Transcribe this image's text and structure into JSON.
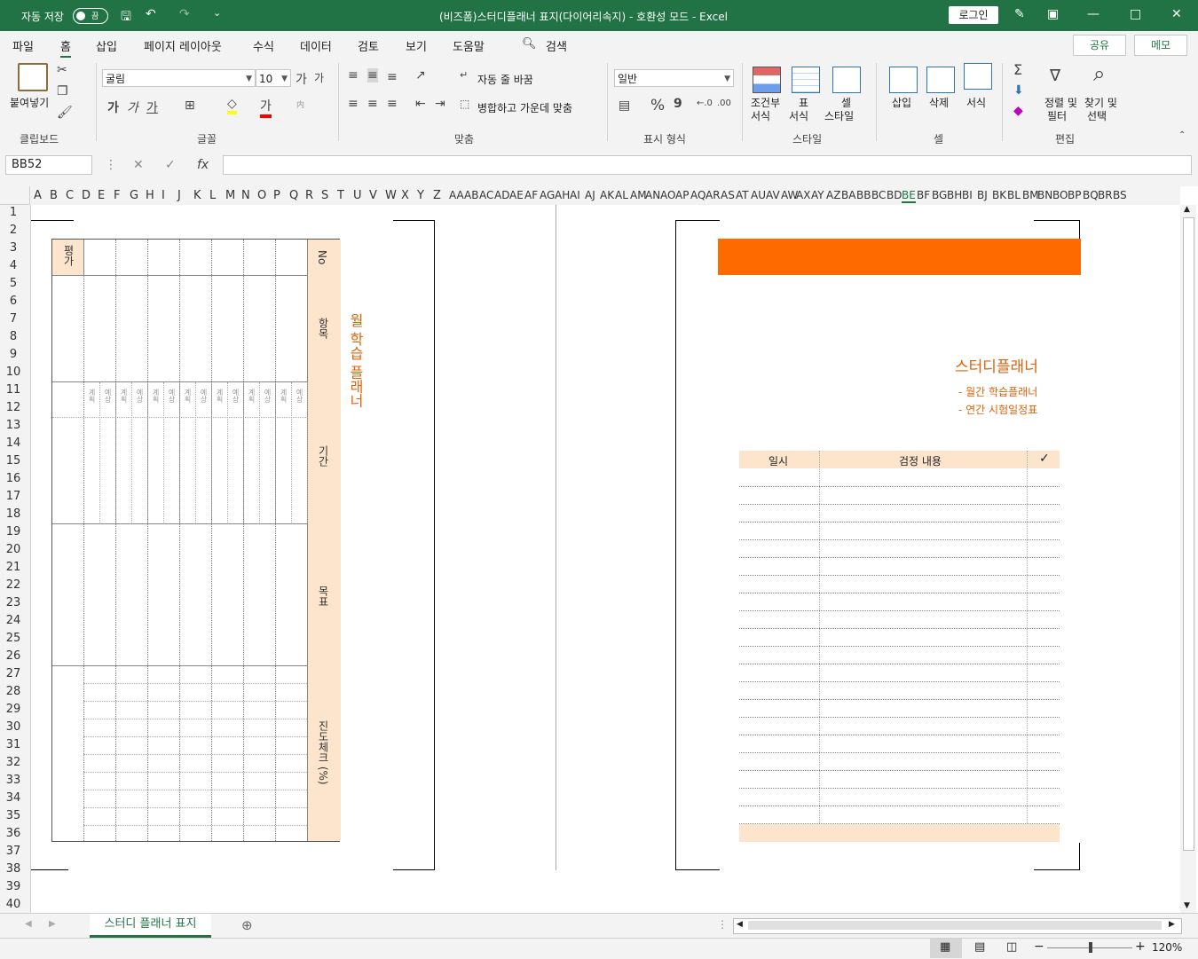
{
  "titlebar": {
    "autosave": "자동 저장",
    "toggle": "끔",
    "title": "(비즈폼)스터디플래너 표지(다이어리속지)  -  호환성 모드  -  Excel",
    "login": "로그인"
  },
  "tabs": [
    "파일",
    "홈",
    "삽입",
    "페이지 레이아웃",
    "수식",
    "데이터",
    "검토",
    "보기",
    "도움말"
  ],
  "search": "검색",
  "share": "공유",
  "memo": "메모",
  "ribbon": {
    "paste": "붙여넣기",
    "clipboard": "클립보드",
    "font_name": "굴림",
    "font_size": "10",
    "font_group": "글꼴",
    "wrap": "자동 줄 바꿈",
    "merge": "병합하고 가운데 맞춤",
    "align_group": "맞춤",
    "number_format": "일반",
    "number_group": "표시 형식",
    "cond_format": [
      "조건부",
      "서식"
    ],
    "table_format": [
      "표",
      "서식"
    ],
    "cell_style": [
      "셀",
      "스타일"
    ],
    "style_group": "스타일",
    "insert": "삽입",
    "delete": "삭제",
    "format": "서식",
    "cells_group": "셀",
    "sort": [
      "정렬 및",
      "필터"
    ],
    "find": [
      "찾기 및",
      "선택"
    ],
    "edit_group": "편집",
    "bold": "가",
    "italic": "가",
    "underline": "가",
    "fontcolor": "가",
    "percent": "%",
    "comma": "9",
    "grow": "가",
    "shrink": "가",
    "sum": "Σ"
  },
  "formula": {
    "namebox": "BB52",
    "fx": "fx",
    "value": ""
  },
  "columns": [
    "A",
    "B",
    "C",
    "D",
    "E",
    "F",
    "G",
    "H",
    "I",
    "J",
    "K",
    "L",
    "M",
    "N",
    "O",
    "P",
    "Q",
    "R",
    "S",
    "T",
    "U",
    "V",
    "W",
    "X",
    "Y",
    "Z",
    "AA",
    "AB",
    "AC",
    "AD",
    "AE",
    "AF",
    "AG",
    "AH",
    "AI",
    "AJ",
    "AK",
    "AL",
    "AM",
    "AN",
    "AO",
    "AP",
    "AQ",
    "AR",
    "AS",
    "AT",
    "AU",
    "AV",
    "AW",
    "AX",
    "AY",
    "AZ",
    "BA",
    "BB",
    "BC",
    "BD",
    "BE",
    "BF",
    "BG",
    "BH",
    "BI",
    "BJ",
    "BK",
    "BL",
    "BM",
    "BN",
    "BO",
    "BP",
    "BQ",
    "BR",
    "BS"
  ],
  "rows": [
    "1",
    "2",
    "3",
    "4",
    "5",
    "6",
    "7",
    "8",
    "9",
    "10",
    "11",
    "12",
    "13",
    "14",
    "15",
    "16",
    "17",
    "18",
    "19",
    "20",
    "21",
    "22",
    "23",
    "24",
    "25",
    "26",
    "27",
    "28",
    "29",
    "30",
    "31",
    "32",
    "33",
    "34",
    "35",
    "36",
    "37",
    "38",
    "39",
    "40"
  ],
  "left_page": {
    "no": "No",
    "subject": "항목",
    "period": "기간",
    "goal": "목표",
    "progress": "진도체크 (%)",
    "eval": "평가",
    "plan_label": "계획",
    "real_label": "예상",
    "title": "월  학습  플래너"
  },
  "right_page": {
    "title": "스터디플래너",
    "sub1": "- 월간 학습플래너",
    "sub2": "- 연간 시험일정표",
    "col_date": "일시",
    "col_content": "검정 내용",
    "col_check": "✓",
    "banner_color": "#ff6a00"
  },
  "sheet_tab": "스터디 플래너 표지",
  "zoom": "120%"
}
